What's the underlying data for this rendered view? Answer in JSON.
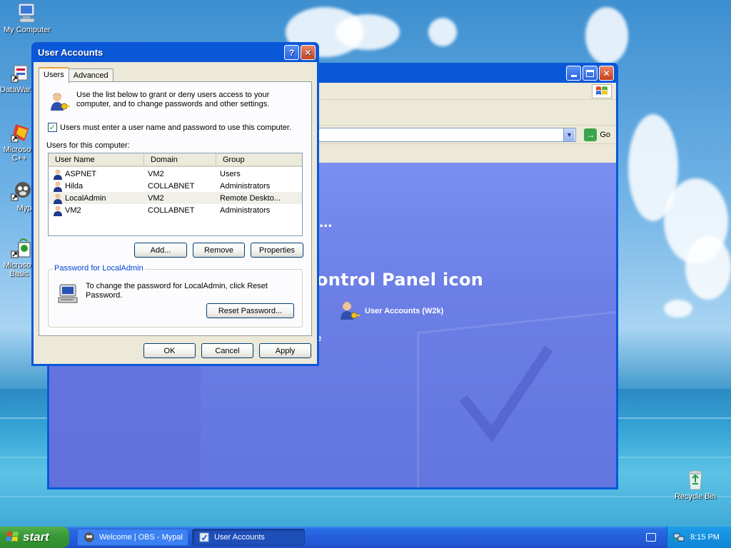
{
  "desktop": {
    "icons": [
      {
        "label": "My Computer",
        "name": "my-computer-icon"
      },
      {
        "label": "DataWar",
        "name": "datawarehouse-shortcut-icon"
      },
      {
        "label": "Microsoft C++",
        "name": "microsoft-cpp-shortcut-icon"
      },
      {
        "label": "Myp",
        "name": "mypal-shortcut-icon"
      },
      {
        "label": "Microsoft Basic",
        "name": "microsoft-basic-shortcut-icon"
      },
      {
        "label": "Recycle Bin",
        "name": "recycle-bin-icon"
      }
    ]
  },
  "control_panel": {
    "heading": "ontrol Panel icon",
    "dots": "...",
    "partial_e": "e",
    "user_accounts_link": "User Accounts (W2k)",
    "go_label": "Go"
  },
  "dialog": {
    "title": "User Accounts",
    "help_button": "?",
    "close_button": "✕",
    "tabs": [
      {
        "label": "Users",
        "active": true
      },
      {
        "label": "Advanced",
        "active": false
      }
    ],
    "intro_text": "Use the list below to grant or deny users access to your computer, and to change passwords and other settings.",
    "require_login_label": "Users must enter a user name and password to use this computer.",
    "require_login_checked": true,
    "users_label": "Users for this computer:",
    "columns": [
      "User Name",
      "Domain",
      "Group"
    ],
    "users": [
      {
        "name": "ASPNET",
        "domain": "VM2",
        "group": "Users"
      },
      {
        "name": "Hilda",
        "domain": "COLLABNET",
        "group": "Administrators"
      },
      {
        "name": "LocalAdmin",
        "domain": "VM2",
        "group": "Remote Deskto..."
      },
      {
        "name": "VM2",
        "domain": "COLLABNET",
        "group": "Administrators"
      }
    ],
    "selected_user_index": 2,
    "add_button": "Add...",
    "remove_button": "Remove",
    "properties_button": "Properties",
    "password_group_label": "Password for LocalAdmin",
    "password_text": "To change the password for LocalAdmin, click Reset Password.",
    "reset_password_button": "Reset Password...",
    "ok_button": "OK",
    "cancel_button": "Cancel",
    "apply_button": "Apply"
  },
  "taskbar": {
    "start_label": "start",
    "tasks": [
      {
        "label": "Welcome | OBS - Mypal",
        "active": false
      },
      {
        "label": "User Accounts",
        "active": true
      }
    ],
    "clock": "8:15 PM"
  },
  "colors": {
    "xp_title_blue": "#0a58d8",
    "dialog_face": "#ece9d8",
    "cp_content_blue": "#6c7fe6",
    "start_green": "#3a9a37",
    "taskbar_blue": "#245edb",
    "group_label_blue": "#0046d5"
  }
}
